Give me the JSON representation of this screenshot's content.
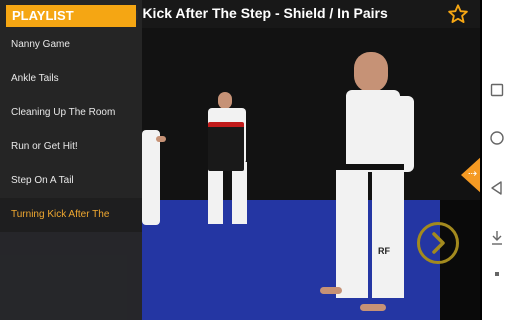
{
  "video": {
    "title": "g Kick After The Step - Shield / In Pairs"
  },
  "playlist": {
    "header": "PLAYLIST",
    "items": [
      {
        "label": "Nanny Game"
      },
      {
        "label": "Ankle Tails"
      },
      {
        "label": "Cleaning Up The Room"
      },
      {
        "label": "Run or Get Hit!"
      },
      {
        "label": "Step On A Tail"
      },
      {
        "label": "Turning Kick After The"
      }
    ],
    "active_index": 5
  },
  "colors": {
    "accent": "#f5a613",
    "active_item": "#f0a830",
    "mat": "#2436a3",
    "next_ring": "#a38a1e"
  },
  "icons": {
    "favorite": "star-outline-icon",
    "next": "chevron-right-icon",
    "side_tab": "collapse-arrow-icon",
    "nav_square": "recent-apps-icon",
    "nav_circle": "home-icon",
    "nav_triangle": "back-icon",
    "nav_download": "download-icon",
    "nav_dot": "dot-icon"
  },
  "figures": {
    "uniform_text": "RF"
  }
}
